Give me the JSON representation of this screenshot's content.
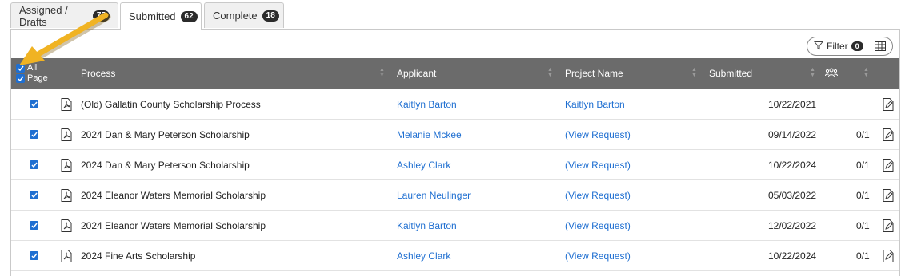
{
  "tabs": [
    {
      "label": "Assigned / Drafts",
      "count": "75"
    },
    {
      "label": "Submitted",
      "count": "62"
    },
    {
      "label": "Complete",
      "count": "18"
    }
  ],
  "toolbar": {
    "filter_label": "Filter",
    "filter_count": "0"
  },
  "header": {
    "all_label": "All",
    "page_label": "Page",
    "process": "Process",
    "applicant": "Applicant",
    "project_name": "Project Name",
    "submitted": "Submitted"
  },
  "rows": [
    {
      "process": "(Old) Gallatin County Scholarship Process",
      "applicant": "Kaitlyn Barton",
      "project": "Kaitlyn Barton",
      "submitted": "10/22/2021",
      "reviews": ""
    },
    {
      "process": "2024 Dan & Mary Peterson Scholarship",
      "applicant": "Melanie Mckee",
      "project": "(View Request)",
      "submitted": "09/14/2022",
      "reviews": "0/1"
    },
    {
      "process": "2024 Dan & Mary Peterson Scholarship",
      "applicant": "Ashley Clark",
      "project": "(View Request)",
      "submitted": "10/22/2024",
      "reviews": "0/1"
    },
    {
      "process": "2024 Eleanor Waters Memorial Scholarship",
      "applicant": "Lauren Neulinger",
      "project": "(View Request)",
      "submitted": "05/03/2022",
      "reviews": "0/1"
    },
    {
      "process": "2024 Eleanor Waters Memorial Scholarship",
      "applicant": "Kaitlyn Barton",
      "project": "(View Request)",
      "submitted": "12/02/2022",
      "reviews": "0/1"
    },
    {
      "process": "2024 Fine Arts Scholarship",
      "applicant": "Ashley Clark",
      "project": "(View Request)",
      "submitted": "10/22/2024",
      "reviews": "0/1"
    }
  ],
  "colors": {
    "header_bg": "#6b6b6b",
    "link": "#1f6fd1",
    "checkbox": "#1f6fd1",
    "arrow": "#f0b323"
  }
}
